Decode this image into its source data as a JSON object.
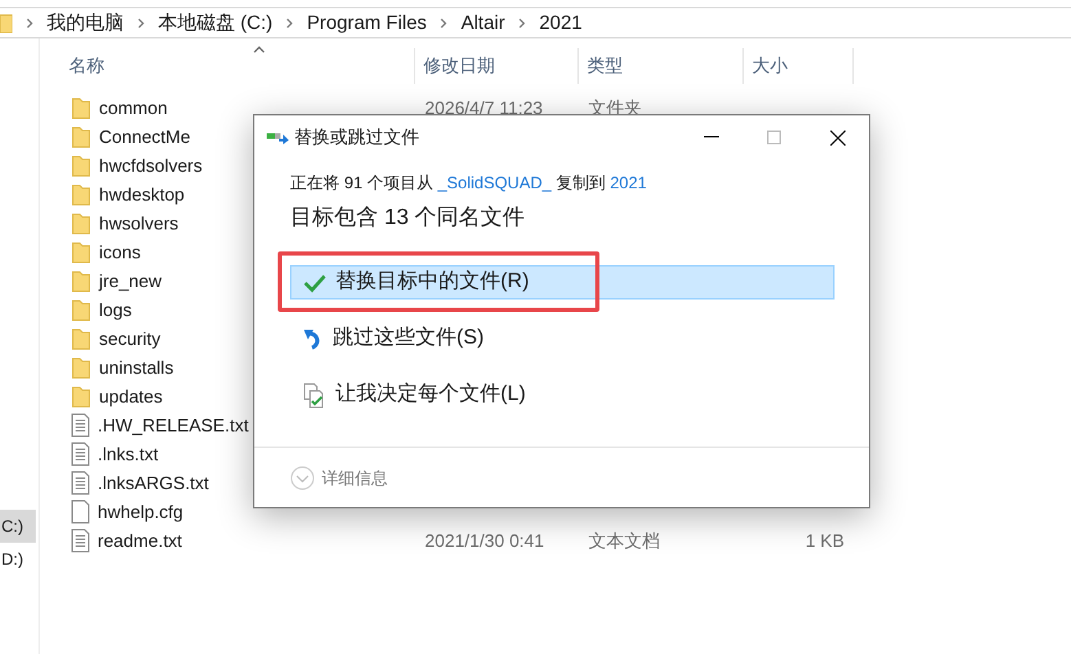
{
  "address_bar": {
    "crumbs": [
      "我的电脑",
      "本地磁盘 (C:)",
      "Program Files",
      "Altair",
      "2021"
    ]
  },
  "nav_pane": {
    "items": [
      {
        "label": "C:)",
        "selected": true
      },
      {
        "label": "D:)",
        "selected": false
      }
    ]
  },
  "columns": [
    "名称",
    "修改日期",
    "类型",
    "大小"
  ],
  "files": [
    {
      "name": "common",
      "kind": "folder",
      "date": "2026/4/7 11:23",
      "type": "文件夹"
    },
    {
      "name": "ConnectMe",
      "kind": "folder"
    },
    {
      "name": "hwcfdsolvers",
      "kind": "folder"
    },
    {
      "name": "hwdesktop",
      "kind": "folder"
    },
    {
      "name": "hwsolvers",
      "kind": "folder"
    },
    {
      "name": "icons",
      "kind": "folder"
    },
    {
      "name": "jre_new",
      "kind": "folder"
    },
    {
      "name": "logs",
      "kind": "folder"
    },
    {
      "name": "security",
      "kind": "folder"
    },
    {
      "name": "uninstalls",
      "kind": "folder"
    },
    {
      "name": "updates",
      "kind": "folder"
    },
    {
      "name": ".HW_RELEASE.txt",
      "kind": "text"
    },
    {
      "name": ".lnks.txt",
      "kind": "text"
    },
    {
      "name": ".lnksARGS.txt",
      "kind": "text"
    },
    {
      "name": "hwhelp.cfg",
      "kind": "blank"
    },
    {
      "name": "readme.txt",
      "kind": "text",
      "date": "2021/1/30 0:41",
      "type": "文本文档",
      "size": "1 KB"
    }
  ],
  "dialog": {
    "title": "替换或跳过文件",
    "message": {
      "prefix": "正在将 91 个项目从 ",
      "source": "_SolidSQUAD_",
      "middle": " 复制到 ",
      "target": "2021"
    },
    "heading": "目标包含 13 个同名文件",
    "options": [
      {
        "kind": "replace",
        "label": "替换目标中的文件(R)",
        "selected": true,
        "annotated": true
      },
      {
        "kind": "skip",
        "label": "跳过这些文件(S)",
        "selected": false,
        "annotated": false
      },
      {
        "kind": "decide",
        "label": "让我决定每个文件(L)",
        "selected": false,
        "annotated": false
      }
    ],
    "details": "详细信息"
  }
}
